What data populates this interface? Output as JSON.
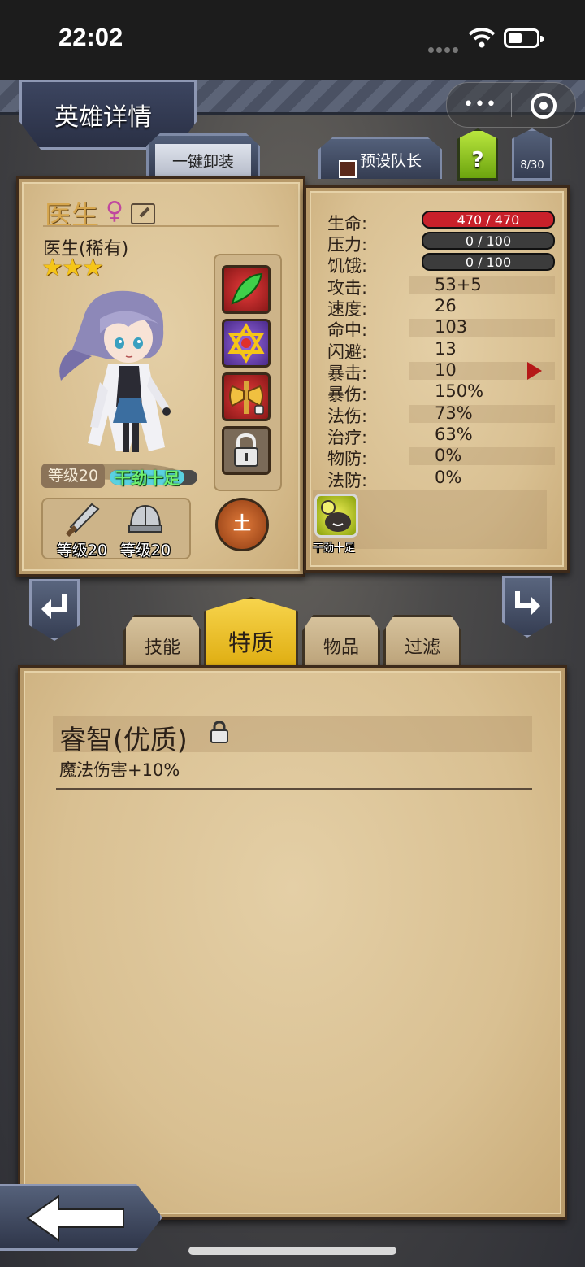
{
  "statusbar": {
    "time": "22:02"
  },
  "header": {
    "title": "英雄详情",
    "menu_dots": "•••"
  },
  "top_tabs": {
    "unequip_all": "一键卸装",
    "preset_captain": "预设队长",
    "help": "?",
    "hero_count": "8/30"
  },
  "hero": {
    "name": "医生",
    "gender_symbol": "♀",
    "class": "医生(稀有)",
    "stars": 3,
    "level_label": "等级20",
    "mood_label": "干劲十足",
    "mood_fraction": 0.85,
    "element": "土",
    "weapon_level": "等级20",
    "armor_level": "等级20"
  },
  "stats": {
    "hp": {
      "label": "生命:",
      "value": "470 / 470",
      "fraction": 1.0
    },
    "stress": {
      "label": "压力:",
      "value": "0 / 100",
      "fraction": 0
    },
    "hunger": {
      "label": "饥饿:",
      "value": "0 / 100",
      "fraction": 0
    },
    "rows": [
      {
        "label": "攻击:",
        "value": "53+5"
      },
      {
        "label": "速度:",
        "value": "26"
      },
      {
        "label": "命中:",
        "value": "103"
      },
      {
        "label": "闪避:",
        "value": "13"
      },
      {
        "label": "暴击:",
        "value": "10"
      },
      {
        "label": "暴伤:",
        "value": "150%"
      },
      {
        "label": "法伤:",
        "value": "73%"
      },
      {
        "label": "治疗:",
        "value": "63%"
      },
      {
        "label": "物防:",
        "value": "0%"
      },
      {
        "label": "法防:",
        "value": "0%"
      }
    ],
    "trait_icon_label": "干劲十足"
  },
  "tabs": [
    {
      "label": "技能",
      "active": false
    },
    {
      "label": "特质",
      "active": true
    },
    {
      "label": "物品",
      "active": false
    },
    {
      "label": "过滤",
      "active": false
    }
  ],
  "trait_panel": {
    "title": "睿智(优质)",
    "description": "魔法伤害+10%"
  },
  "colors": {
    "hp_bar": "#c8202a",
    "tab_active": "#f2c43a",
    "parchment": "#dcc497",
    "nav_blue": "#47526b"
  }
}
